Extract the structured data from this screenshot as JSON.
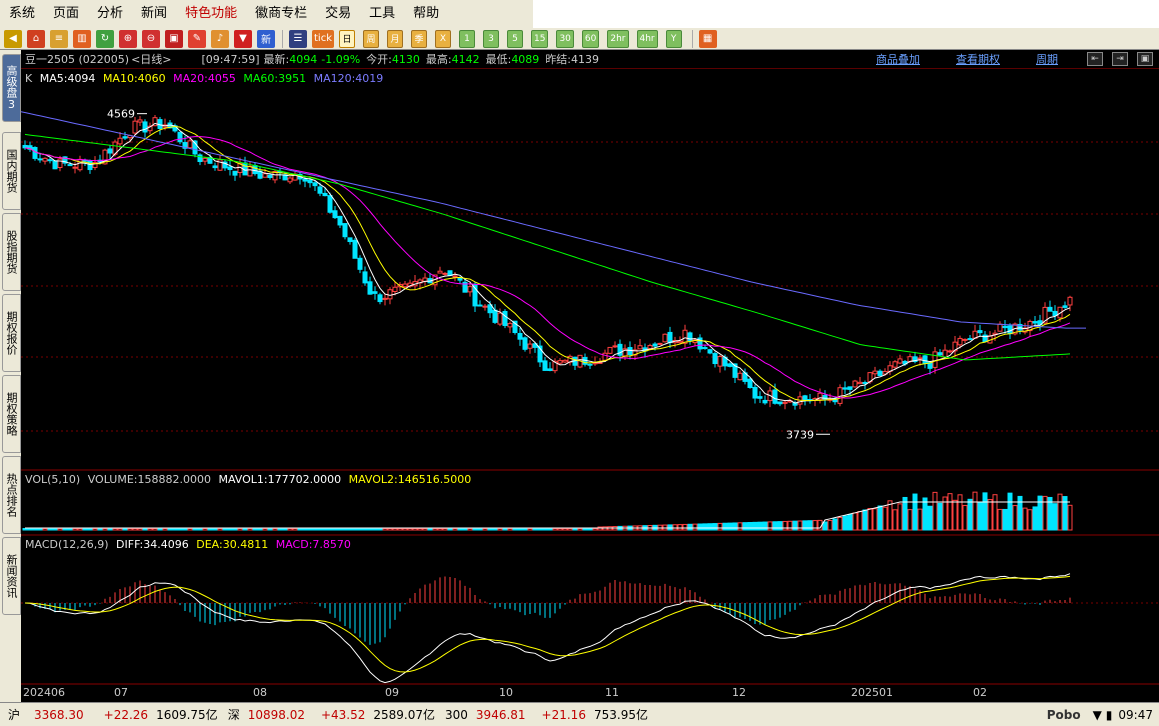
{
  "menu": {
    "items": [
      "系统",
      "页面",
      "分析",
      "新闻",
      "特色功能",
      "徽商专栏",
      "交易",
      "工具",
      "帮助"
    ]
  },
  "toolbar": {
    "icons": [
      "back-icon",
      "home-icon",
      "layers-icon",
      "book-icon",
      "refresh-icon",
      "zoom-in-icon",
      "zoom-out-icon",
      "window-icon",
      "pen-icon",
      "bell-icon",
      "filter-icon",
      "new-icon",
      "list-icon",
      "tick-icon",
      "day-icon"
    ],
    "new_label": "新",
    "tick_label": "tick",
    "periods": [
      "日",
      "周",
      "月",
      "季",
      "X",
      "1",
      "3",
      "5",
      "15",
      "30",
      "60",
      "2hr",
      "4hr",
      "Y"
    ],
    "selected_period": "日"
  },
  "sidebar": {
    "tabs": [
      "高级盘3",
      "国内期货",
      "股指期货",
      "期权报价",
      "期权策略",
      "热点排名",
      "新闻资讯"
    ]
  },
  "infobar": {
    "symbol": "豆一2505 (022005)",
    "period": "<日线>",
    "time": "[09:47:59]",
    "latest_label": "最新:",
    "latest": "4094",
    "change": "-1.09%",
    "open_label": "今开:",
    "open": "4130",
    "high_label": "最高:",
    "high": "4142",
    "low_label": "最低:",
    "low": "4089",
    "prev_label": "昨结:",
    "prev": "4139",
    "links": [
      "商品叠加",
      "查看期权",
      "周期"
    ]
  },
  "ma": {
    "k": "K",
    "ma5": "MA5:4094",
    "ma10": "MA10:4060",
    "ma20": "MA20:4055",
    "ma60": "MA60:3951",
    "ma120": "MA120:4019"
  },
  "annotations": {
    "high": "4569",
    "low": "3739"
  },
  "vol": {
    "name": "VOL(5,10)",
    "volume": "VOLUME:158882.0000",
    "mavol1": "MAVOL1:177702.0000",
    "mavol2": "MAVOL2:146516.5000"
  },
  "macd": {
    "name": "MACD(12,26,9)",
    "diff": "DIFF:34.4096",
    "dea": "DEA:30.4811",
    "macd": "MACD:7.8570"
  },
  "xaxis": {
    "labels": [
      "202406",
      "07",
      "08",
      "09",
      "10",
      "11",
      "12",
      "202501",
      "02"
    ]
  },
  "status": {
    "sh_label": "沪",
    "sh_val": "3368.30",
    "sh_chg": "+22.26",
    "sh_amt": "1609.75亿",
    "sz_label": "深",
    "sz_val": "10898.02",
    "sz_chg": "+43.52",
    "sz_amt": "2589.07亿",
    "i300_label": "300",
    "i300_val": "3946.81",
    "i300_chg": "+21.16",
    "i300_amt": "753.95亿",
    "brand": "Pobo",
    "time": "09:47"
  },
  "colors": {
    "up": "#ff4040",
    "down": "#00e5ff",
    "ma5": "#ffffff",
    "ma10": "#ffff00",
    "ma20": "#ff00ff",
    "ma60": "#00ff00",
    "ma120": "#6a6aff",
    "grid": "#7a0000"
  },
  "chart_data": {
    "type": "candlestick",
    "xlabels": [
      "202406",
      "07",
      "08",
      "09",
      "10",
      "11",
      "12",
      "202501",
      "02"
    ],
    "close_anchors": [
      4495,
      4450,
      4455,
      4545,
      4560,
      4470,
      4440,
      4420,
      4430,
      4300,
      4100,
      4120,
      4180,
      4090,
      4010,
      3920,
      3935,
      3960,
      3980,
      4010,
      3930,
      3840,
      3835,
      3830,
      3870,
      3920,
      3930,
      3990,
      4010,
      4040,
      4094
    ],
    "ma120_anchors": [
      4590,
      4530,
      4470,
      4410,
      4350,
      4280,
      4210,
      4140,
      4080,
      4035,
      4019
    ],
    "ma60_anchors": [
      4530,
      4495,
      4460,
      4400,
      4320,
      4230,
      4140,
      4060,
      3975,
      3935,
      3951
    ],
    "annotations": {
      "high": 4569,
      "low": 3739
    }
  }
}
